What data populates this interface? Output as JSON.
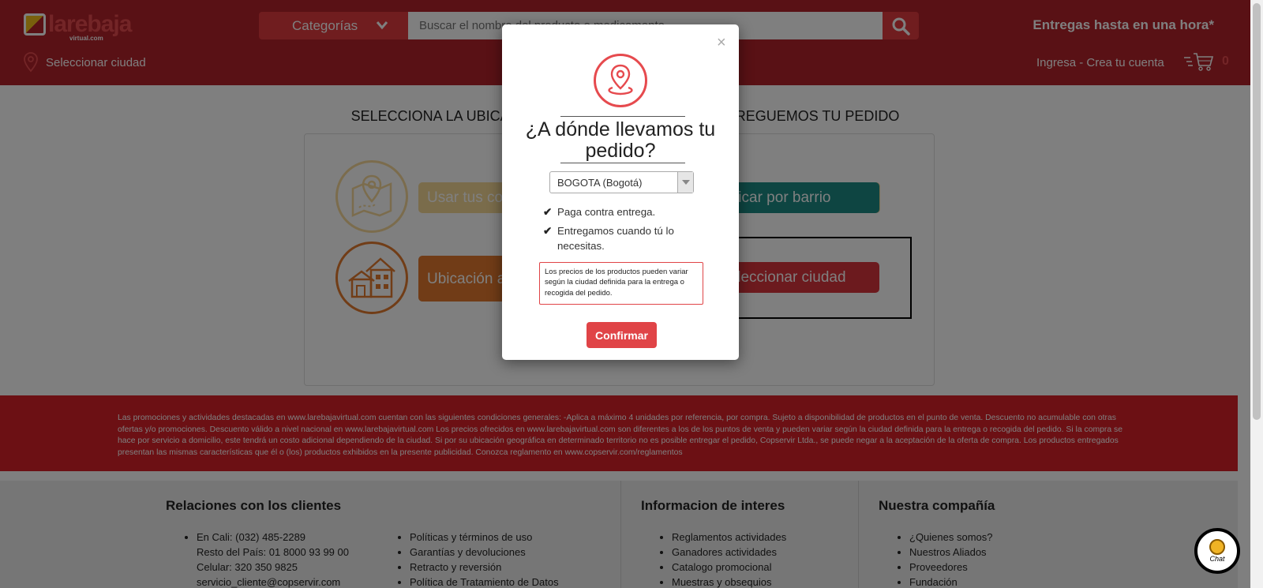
{
  "header": {
    "logo_text": "larebaja",
    "logo_sub": "virtual.com",
    "categories_label": "Categorías",
    "search_placeholder": "Buscar el nombre del producto o medicamento",
    "delivery_text": "Entregas hasta en una hora*",
    "select_city_label": "Seleccionar ciudad",
    "account_link": "Ingresa - Crea tu cuenta",
    "cart_count": "0",
    "colors": {
      "bar": "#b3222a",
      "accent": "#e03a3e"
    }
  },
  "main": {
    "title": "SELECCIONA LA UBICACIÓN DONDE QUIERES QUE ENTREGUEMOS TU PEDIDO",
    "options": {
      "gps": "Usar tus coordenadas",
      "auto": "Ubicación automática",
      "barrio": "Ubicar por barrio",
      "city": "Seleccionar ciudad"
    }
  },
  "modal": {
    "title": "¿A dónde llevamos tu pedido?",
    "selected_city": "BOGOTA (Bogotá)",
    "benefits": [
      "Paga contra entrega.",
      "Entregamos cuando tú lo necesitas."
    ],
    "notice": "Los precios de los productos pueden variar según la ciudad definida para la entrega o recogida del pedido.",
    "confirm_label": "Confirmar",
    "close_symbol": "×"
  },
  "legal_text": "Las promociones y actividades destacadas en www.larebajavirtual.com cuentan con las siguientes condiciones generales: -Aplica a máximo 4 unidades por referencia, por compra. Sujeto a disponibilidad de productos en el punto de venta. Descuento no acumulable con otras ofertas y/o promociones. Descuento válido a nivel nacional en www.larebajavirtual.com Los precios ofrecidos en www.larebajavirtual.com son diferentes a los de los puntos de venta y pueden variar según la ciudad definida para la entrega o recogida del pedido. Si la compra se hace por servicio a domicilio, este tendrá un costo adicional dependiendo de la ciudad. Si por su ubicación geográfica en determinado territorio no es posible entregar el pedido, Copservir Ltda., se puede negar a la aceptación de la oferta de compra. Los productos entregados presentan las mismas características que él o (los) productos exhibidos en la presente publicidad. Conozca reglamento en www.copservir.com/reglamentos",
  "footer": {
    "col1": {
      "title": "Relaciones con los clientes",
      "contact": [
        "En Cali: (032) 485-2289",
        "Resto del País: 01 8000 93 99 00",
        "Celular: 320 350 9825",
        "servicio_cliente@copservir.com"
      ],
      "links": [
        "Políticas y términos de uso",
        "Garantías y devoluciones",
        "Retracto y reversión",
        "Política de Tratamiento de Datos"
      ]
    },
    "col2": {
      "title": "Informacion de interes",
      "links": [
        "Reglamentos actividades",
        "Ganadores actividades",
        "Catalogo promocional",
        "Muestras y obsequios"
      ]
    },
    "col3": {
      "title": "Nuestra compañía",
      "links": [
        "¿Quienes somos?",
        "Nuestros Aliados",
        "Proveedores",
        "Fundación"
      ]
    }
  },
  "chat_label": "Chat"
}
